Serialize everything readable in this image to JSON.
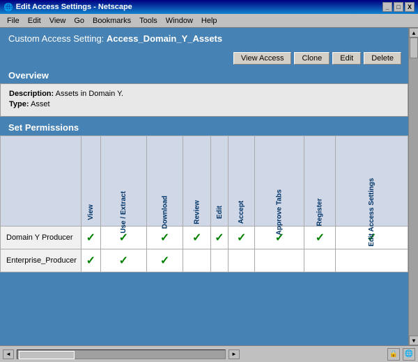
{
  "window": {
    "title": "Edit Access Settings - Netscape",
    "controls": [
      "_",
      "□",
      "X"
    ]
  },
  "menubar": {
    "items": [
      "File",
      "Edit",
      "View",
      "Go",
      "Bookmarks",
      "Tools",
      "Window",
      "Help"
    ]
  },
  "header": {
    "prefix": "Custom Access Setting: ",
    "title": "Access_Domain_Y_Assets"
  },
  "toolbar": {
    "buttons": [
      "View Access",
      "Clone",
      "Edit",
      "Delete"
    ]
  },
  "overview": {
    "section_label": "Overview",
    "description_label": "Description:",
    "description_value": "Assets in Domain Y.",
    "type_label": "Type:",
    "type_value": "Asset"
  },
  "permissions": {
    "section_label": "Set Permissions",
    "columns": [
      "View",
      "Use / Extract",
      "Download",
      "Review",
      "Edit",
      "Accept",
      "Approve Tabs",
      "Register",
      "Edit Access Settings"
    ],
    "rows": [
      {
        "name": "Domain Y Producer",
        "checks": [
          true,
          true,
          true,
          true,
          true,
          true,
          true,
          true,
          true
        ]
      },
      {
        "name": "Enterprise_Producer",
        "checks": [
          true,
          true,
          true,
          false,
          false,
          false,
          false,
          false,
          false
        ]
      }
    ]
  },
  "icons": {
    "checkmark": "✓",
    "arrow_up": "▲",
    "arrow_down": "▼",
    "arrow_left": "◄",
    "arrow_right": "►"
  }
}
